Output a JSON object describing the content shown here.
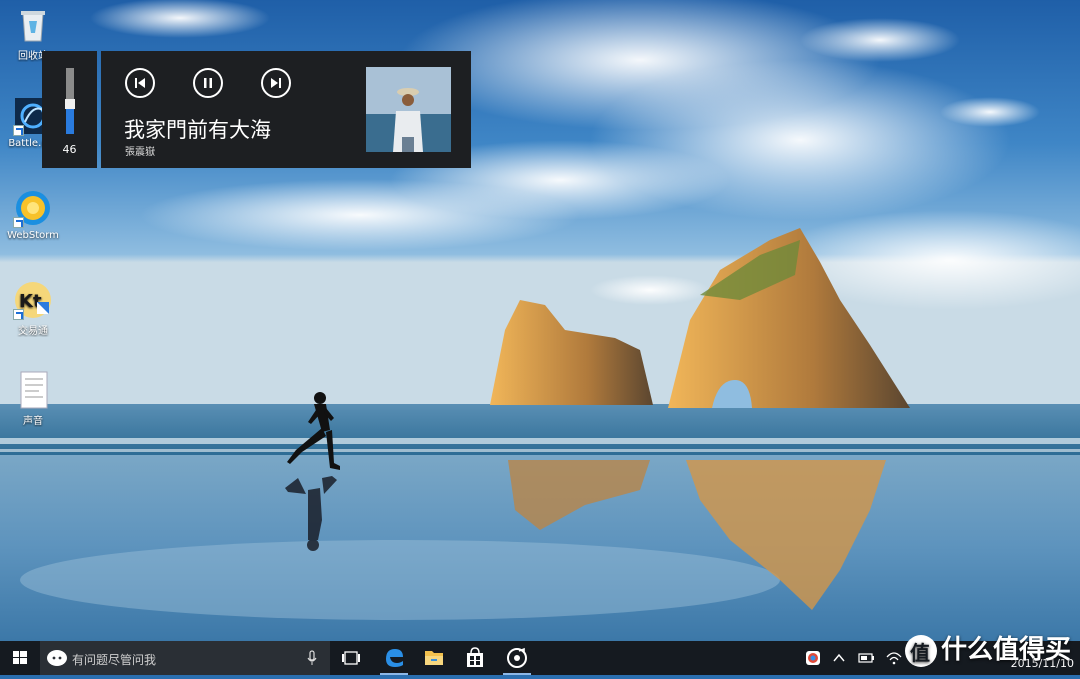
{
  "desktop": {
    "icons": [
      {
        "name": "recycle-bin",
        "label": "回收站"
      },
      {
        "name": "battlenet",
        "label": "Battle.net"
      },
      {
        "name": "webstorm",
        "label": "WebStorm"
      },
      {
        "name": "kuaiyi",
        "label": "交易通"
      },
      {
        "name": "sound-file",
        "label": "声音"
      }
    ]
  },
  "volume": {
    "level": 46,
    "display": "46",
    "accent": "#2a7bde"
  },
  "media": {
    "title": "我家門前有大海",
    "artist": "張震嶽",
    "controls": {
      "previous": "previous-icon",
      "pause": "pause-icon",
      "next": "next-icon"
    }
  },
  "taskbar": {
    "search_placeholder": "有问题尽管问我",
    "pinned": [
      {
        "name": "task-view",
        "icon": "task-view-icon"
      },
      {
        "name": "edge",
        "icon": "edge-icon"
      },
      {
        "name": "file-explorer",
        "icon": "folder-icon"
      },
      {
        "name": "store",
        "icon": "store-icon"
      },
      {
        "name": "groove-music",
        "icon": "groove-icon"
      }
    ],
    "clock_date": "2015/11/10"
  },
  "watermark": {
    "text": "什么值得买"
  }
}
